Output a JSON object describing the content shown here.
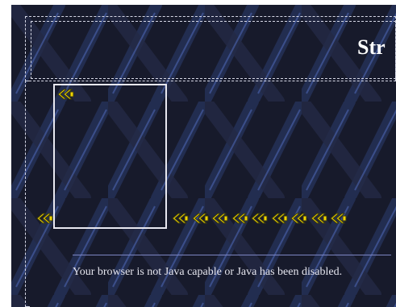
{
  "page": {
    "title_fragment": "Str",
    "java_message": "Your browser is not Java capable or Java has been disabled."
  },
  "colors": {
    "background": "#171a2b",
    "pattern": "#2b3b6e",
    "chevron_fill": "#f0d400",
    "chevron_outline": "#3a3a10",
    "box_border": "#e8e8f0",
    "text": "#e6e6ef"
  },
  "icons": {
    "chevron": "double-left-chevron-icon",
    "count_top": 1,
    "count_bottom_left": 1,
    "count_bottom_right": 9
  }
}
